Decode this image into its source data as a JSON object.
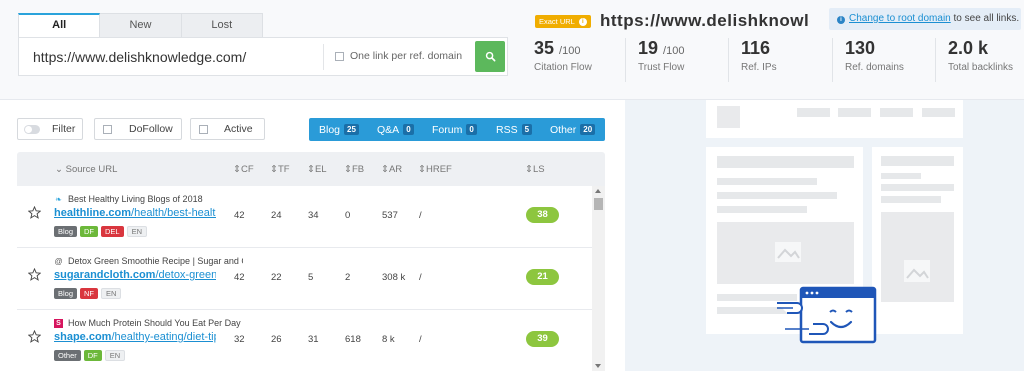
{
  "tabs": [
    {
      "label": "All",
      "active": true
    },
    {
      "label": "New",
      "active": false
    },
    {
      "label": "Lost",
      "active": false
    }
  ],
  "search": {
    "url_value": "https://www.delishknowledge.com/",
    "one_link_label": "One link per ref. domain",
    "submit_icon": "search-icon"
  },
  "header": {
    "exact_badge": "Exact URL",
    "site_title": "https://www.delishknowledge.com/",
    "root_notice": {
      "link_text": "Change to root domain",
      "suffix": " to see all links."
    }
  },
  "metrics": [
    {
      "value": "35",
      "suffix": "/100",
      "label": "Citation Flow"
    },
    {
      "value": "19",
      "suffix": "/100",
      "label": "Trust Flow"
    },
    {
      "value": "116",
      "suffix": "",
      "label": "Ref. IPs"
    },
    {
      "value": "130",
      "suffix": "",
      "label": "Ref. domains"
    },
    {
      "value": "2.0 k",
      "suffix": "",
      "label": "Total backlinks"
    }
  ],
  "filters": {
    "filter_label": "Filter",
    "dofollow_label": "DoFollow",
    "active_label": "Active",
    "segments": [
      {
        "label": "Blog",
        "count": "25"
      },
      {
        "label": "Q&A",
        "count": "0"
      },
      {
        "label": "Forum",
        "count": "0"
      },
      {
        "label": "RSS",
        "count": "5"
      },
      {
        "label": "Other",
        "count": "20"
      }
    ]
  },
  "table": {
    "columns": {
      "source": "Source URL",
      "cf": "CF",
      "tf": "TF",
      "el": "EL",
      "fb": "FB",
      "ar": "AR",
      "href": "HREF",
      "ls": "LS"
    },
    "rows": [
      {
        "favicon": "leaf-icon",
        "title": "Best Healthy Living Blogs of 2018",
        "domain": "healthline.com",
        "path": "/health/best-healthy-living-blogs",
        "tags": [
          {
            "text": "Blog",
            "kind": "blog"
          },
          {
            "text": "DF",
            "kind": "df"
          },
          {
            "text": "DEL",
            "kind": "del"
          },
          {
            "text": "EN",
            "kind": "lang"
          }
        ],
        "cf": "42",
        "tf": "24",
        "el": "34",
        "fb": "0",
        "ar": "537",
        "href": "/",
        "ls": "38"
      },
      {
        "favicon": "swirl-icon",
        "title": "Detox Green Smoothie Recipe | Sugar and Cloth",
        "domain": "sugarandcloth.com",
        "path": "/detox-green-smoothie-recipe",
        "tags": [
          {
            "text": "Blog",
            "kind": "blog"
          },
          {
            "text": "NF",
            "kind": "nf"
          },
          {
            "text": "EN",
            "kind": "lang"
          }
        ],
        "cf": "42",
        "tf": "22",
        "el": "5",
        "fb": "2",
        "ar": "308 k",
        "href": "/",
        "ls": "21"
      },
      {
        "favicon": "shape-s-icon",
        "title": "How Much Protein Should You Eat Per Day",
        "domain": "shape.com",
        "path": "/healthy-eating/diet-tips/how-much-protein",
        "tags": [
          {
            "text": "Other",
            "kind": "other"
          },
          {
            "text": "DF",
            "kind": "df"
          },
          {
            "text": "EN",
            "kind": "lang"
          }
        ],
        "cf": "32",
        "tf": "26",
        "el": "31",
        "fb": "618",
        "ar": "8 k",
        "href": "/",
        "ls": "39"
      }
    ]
  },
  "colors": {
    "accent": "#2a9bd8",
    "go_button": "#5cb85c",
    "ls_badge": "#8dc63f",
    "exact_badge": "#f0ad00",
    "link": "#1b8fd2"
  }
}
